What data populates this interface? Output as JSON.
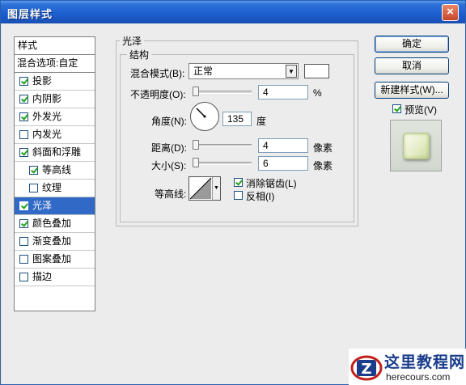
{
  "window": {
    "title": "图层样式",
    "close_label": "×"
  },
  "style_list": {
    "header": "样式",
    "blend_options": "混合选项:自定",
    "items": [
      {
        "label": "投影",
        "checked": true,
        "sub": false,
        "selected": false
      },
      {
        "label": "内阴影",
        "checked": true,
        "sub": false,
        "selected": false
      },
      {
        "label": "外发光",
        "checked": true,
        "sub": false,
        "selected": false
      },
      {
        "label": "内发光",
        "checked": false,
        "sub": false,
        "selected": false
      },
      {
        "label": "斜面和浮雕",
        "checked": true,
        "sub": false,
        "selected": false
      },
      {
        "label": "等高线",
        "checked": true,
        "sub": true,
        "selected": false
      },
      {
        "label": "纹理",
        "checked": false,
        "sub": true,
        "selected": false
      },
      {
        "label": "光泽",
        "checked": true,
        "sub": false,
        "selected": true
      },
      {
        "label": "颜色叠加",
        "checked": true,
        "sub": false,
        "selected": false
      },
      {
        "label": "渐变叠加",
        "checked": false,
        "sub": false,
        "selected": false
      },
      {
        "label": "图案叠加",
        "checked": false,
        "sub": false,
        "selected": false
      },
      {
        "label": "描边",
        "checked": false,
        "sub": false,
        "selected": false
      }
    ]
  },
  "satin": {
    "group_title": "光泽",
    "structure_title": "结构",
    "blend_mode_label": "混合模式(B):",
    "blend_mode_value": "正常",
    "opacity_label": "不透明度(O):",
    "opacity_value": "4",
    "opacity_unit": "%",
    "angle_label": "角度(N):",
    "angle_value": "135",
    "angle_unit": "度",
    "distance_label": "距离(D):",
    "distance_value": "4",
    "distance_unit": "像素",
    "size_label": "大小(S):",
    "size_value": "6",
    "size_unit": "像素",
    "contour_label": "等高线:",
    "anti_alias_label": "消除锯齿(L)",
    "anti_alias_checked": true,
    "invert_label": "反相(I)",
    "invert_checked": false,
    "color_swatch": "#ffffff"
  },
  "buttons": {
    "ok": "确定",
    "cancel": "取消",
    "new_style": "新建样式(W)...",
    "preview_label": "预览(V)",
    "preview_checked": true
  },
  "watermark": {
    "name": "这里教程网",
    "url": "herecours.com",
    "logo_letter": "Z"
  },
  "colors": {
    "selection": "#3169c6",
    "titlebar": "#1e5fcf",
    "watermark_text": "#1a3c8a"
  }
}
